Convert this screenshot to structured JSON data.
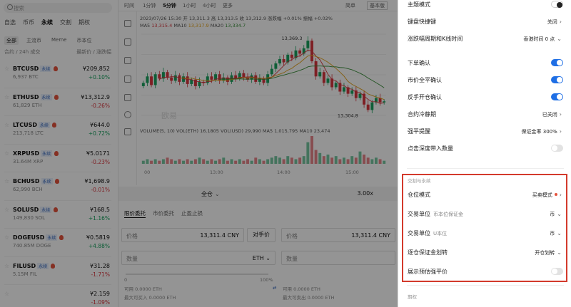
{
  "left": {
    "search_placeholder": "搜索",
    "tabs": [
      "自选",
      "币币",
      "永续",
      "交割",
      "期权"
    ],
    "active_tab": "永续",
    "subtabs": [
      "全部",
      "主流币",
      "Meme",
      "币本位"
    ],
    "header_left": "合约 / 24h 成交",
    "header_right": "最新价 / 涨跌幅",
    "badge": "永续",
    "rows": [
      {
        "symbol": "BTCUSD",
        "vol": "6,937 BTC",
        "price": "¥209,852",
        "change": "+0.10%",
        "dir": "up"
      },
      {
        "symbol": "ETHUSD",
        "vol": "61,829 ETH",
        "price": "¥13,312.9",
        "change": "-0.26%",
        "dir": "down"
      },
      {
        "symbol": "LTCUSD",
        "vol": "213,718 LTC",
        "price": "¥644.0",
        "change": "+0.72%",
        "dir": "up"
      },
      {
        "symbol": "XRPUSD",
        "vol": "31.64M XRP",
        "price": "¥5.0171",
        "change": "-0.23%",
        "dir": "down"
      },
      {
        "symbol": "BCHUSD",
        "vol": "62,990 BCH",
        "price": "¥1,698.9",
        "change": "-0.01%",
        "dir": "down"
      },
      {
        "symbol": "SOLUSD",
        "vol": "149,830 SOL",
        "price": "¥168.5",
        "change": "+1.16%",
        "dir": "up"
      },
      {
        "symbol": "DOGEUSD",
        "vol": "740.85M DOGE",
        "price": "¥0.5819",
        "change": "+4.88%",
        "dir": "up"
      },
      {
        "symbol": "FILUSD",
        "vol": "5.15M FIL",
        "price": "¥31.28",
        "change": "-1.71%",
        "dir": "down"
      },
      {
        "symbol": "",
        "vol": "",
        "price": "¥2.159",
        "change": "-1.09%",
        "dir": "down"
      }
    ]
  },
  "chart": {
    "intervals": [
      "时间",
      "1分钟",
      "5分钟",
      "1小时",
      "4小时",
      "更多"
    ],
    "active_interval": "5分钟",
    "toolbar_right": [
      "简单",
      "基本版"
    ],
    "ohlc_line": "2023/07/26 15:30  开 13,311.3  高 13,313.5  收 13,312.9  涨跌幅 +0.01%  振幅 +0.02%",
    "ma_line_prefix": "MA5",
    "ma5": "13,315.4",
    "ma10": "13,317.9",
    "ma20": "13,334.7",
    "ma_labels": [
      "MA5",
      "MA10",
      "MA20"
    ],
    "high_label": "13,369.3",
    "low_label": "13,304.8",
    "volume_line": "VOLUME(5, 10)  VOL(ETH) 16.1805  VOL(USD) 29,990  MA5 1,015,795  MA10 23,474",
    "time_ticks": [
      "00",
      "13:00",
      "14:00",
      "15:00"
    ],
    "watermark": "欧易",
    "candle_closes": [
      13330,
      13336,
      13328,
      13338,
      13334,
      13340,
      13335,
      13332,
      13337,
      13331,
      13336,
      13329,
      13333,
      13327,
      13331,
      13330,
      13336,
      13333,
      13338,
      13332,
      13335,
      13331,
      13337,
      13334,
      13339,
      13335,
      13333,
      13337,
      13331,
      13334,
      13330,
      13338,
      13343,
      13348,
      13352,
      13349,
      13356,
      13353,
      13360,
      13357,
      13362,
      13369,
      13350,
      13336,
      13340,
      13330,
      13334,
      13326,
      13330,
      13322,
      13326,
      13320,
      13323,
      13316,
      13320,
      13310,
      13305,
      13312,
      13316,
      13312,
      13313
    ],
    "volumes": [
      2,
      3,
      2,
      3,
      2,
      3,
      4,
      3,
      2,
      3,
      2,
      3,
      2,
      3,
      4,
      3,
      2,
      3,
      2,
      3,
      4,
      2,
      3,
      2,
      3,
      2,
      3,
      2,
      4,
      3,
      2,
      3,
      4,
      5,
      4,
      3,
      5,
      4,
      3,
      4,
      5,
      14,
      18,
      9,
      7,
      5,
      6,
      4,
      5,
      3,
      4,
      3,
      5,
      4,
      8,
      6,
      4,
      3,
      4,
      3,
      2
    ]
  },
  "bottom_bar": {
    "mode": "全仓",
    "leverage": "3.00x"
  },
  "order": {
    "tabs": [
      "限价委托",
      "市价委托",
      "止盈止损"
    ],
    "price_label": "价格",
    "price_value": "13,311.4 CNY",
    "counter_price": "对手价",
    "qty_label": "数量",
    "qty_unit": "ETH",
    "avail_label": "可用 0.0000 ETH",
    "max_buy": "最大可买入 0.0000 ETH",
    "avail_label_2": "可用 0.0000 ETH",
    "max_sell": "最大可卖出 0.0000 ETH",
    "slider_0": "0",
    "slider_100": "100%"
  },
  "panel": {
    "rows": [
      {
        "label": "主题模式",
        "kind": "themetoggle"
      },
      {
        "label": "键盘快捷键",
        "value": "关闭",
        "kind": "chev"
      },
      {
        "label": "涨跌幅周期和K线时间",
        "value": "香港时间 0 点",
        "kind": "drop"
      },
      {
        "label": "下单确认",
        "kind": "on"
      },
      {
        "label": "市价全平确认",
        "kind": "on"
      },
      {
        "label": "反手开仓确认",
        "kind": "on"
      },
      {
        "label": "合约冷静期",
        "value": "已关闭",
        "kind": "chev"
      },
      {
        "label": "强平提醒",
        "value": "保证金率 300%",
        "kind": "chev"
      },
      {
        "label": "点击深度带入数量",
        "kind": "off"
      }
    ],
    "section_title": "交割与永续",
    "section_rows": [
      {
        "label": "仓位模式",
        "sub": "",
        "value": "买卖模式",
        "kind": "dotchev"
      },
      {
        "label": "交易单位",
        "sub": "币本位保证金",
        "value": "币",
        "kind": "drop"
      },
      {
        "label": "交易单位",
        "sub": "U本位",
        "value": "币",
        "kind": "drop"
      },
      {
        "label": "逐仓保证金划转",
        "sub": "",
        "value": "开仓划转",
        "kind": "drop"
      },
      {
        "label": "展示预估强平价",
        "sub": "",
        "kind": "off"
      }
    ],
    "section2_title": "期权"
  }
}
